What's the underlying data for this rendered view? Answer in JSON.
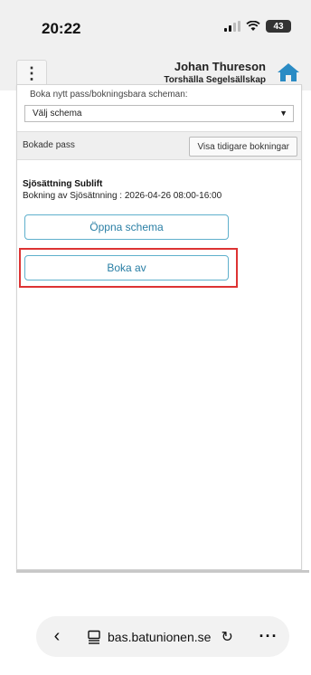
{
  "status_bar": {
    "time": "20:22",
    "battery": "43"
  },
  "header": {
    "menu_glyph": "⋮",
    "user_name": "Johan Thureson",
    "club_name": "Torshälla Segelsällskap",
    "home_color": "#2a8bc4"
  },
  "panel": {
    "book_new_label": "Boka nytt pass/bokningsbara scheman:",
    "schema_select_value": "Välj schema",
    "booked_label": "Bokade pass",
    "show_earlier_button": "Visa tidigare bokningar"
  },
  "booking": {
    "title": "Sjösättning Sublift",
    "detail": "Bokning av Sjösätnning : 2026-04-26 08:00-16:00",
    "open_schema_button": "Öppna schema",
    "cancel_button": "Boka av"
  },
  "browser": {
    "url": "bas.batunionen.se",
    "back_glyph": "‹",
    "more_glyph": "···"
  },
  "colors": {
    "accent": "#2a7fa5",
    "highlight": "#dd3333"
  }
}
